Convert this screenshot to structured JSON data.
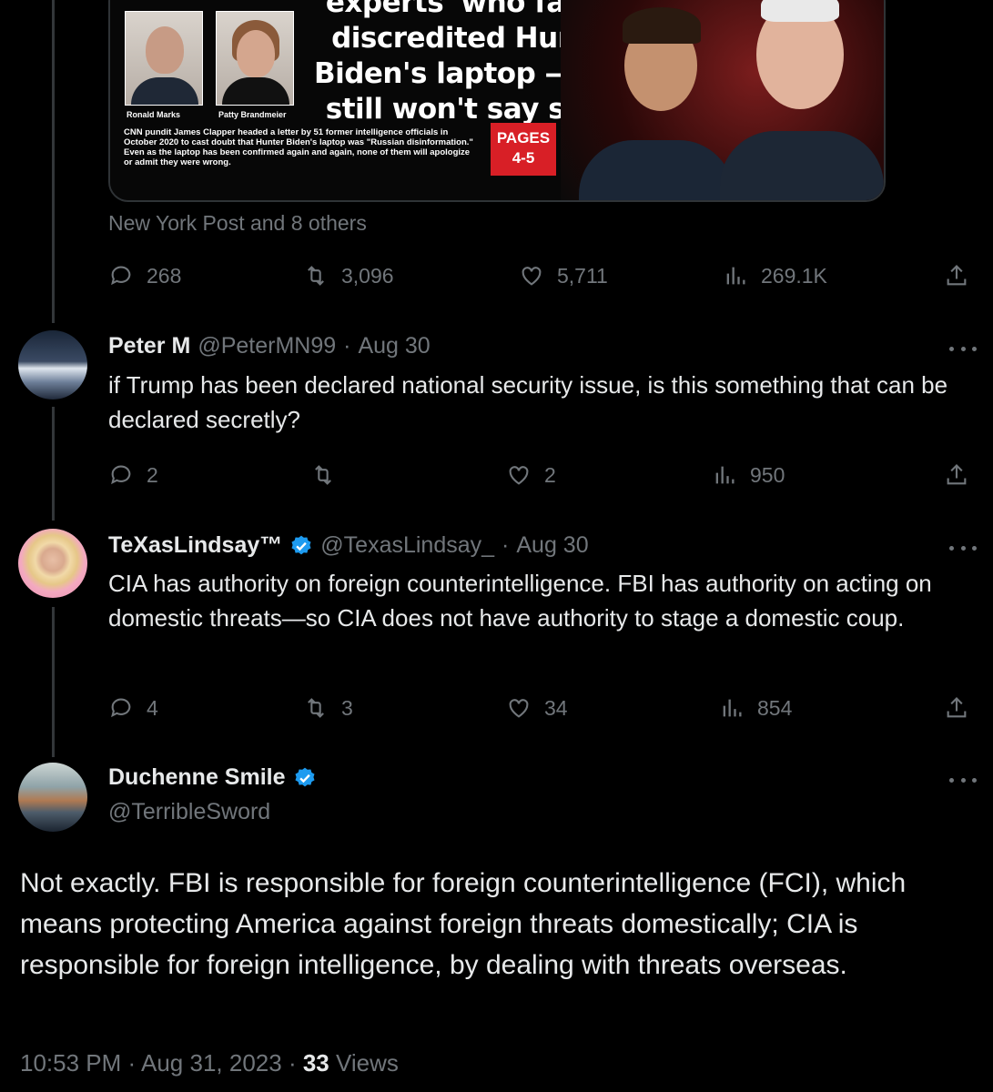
{
  "news_card": {
    "headline": "'experts' who falsely discredited Hunter Biden's laptop — and still won't say sorry",
    "photo_captions": [
      "Ronald Marks",
      "Patty Brandmeier"
    ],
    "body": "CNN pundit James Clapper headed a letter by 51 former intelligence officials in October 2020 to cast doubt that Hunter Biden's laptop was \"Russian disinformation.\" Even as the laptop has been confirmed again and again, none of them will apologize or admit they were wrong.",
    "pages_label": "PAGES",
    "pages_value": "4-5"
  },
  "source_line": "New York Post and 8 others",
  "main_post_actions": {
    "replies": "268",
    "reposts": "3,096",
    "likes": "5,711",
    "views": "269.1K"
  },
  "replies": [
    {
      "name": "Peter M",
      "handle": "@PeterMN99",
      "date": "Aug 30",
      "text": "if Trump has been declared national security issue, is this something that can be declared secretly?",
      "replies": "2",
      "reposts": "",
      "likes": "2",
      "views": "950"
    },
    {
      "name": "TeXasLindsay™",
      "handle": "@TexasLindsay_",
      "date": "Aug 30",
      "text": "CIA has authority on foreign counterintelligence. FBI has authority on acting on domestic threats—so CIA does not have authority to stage a domestic coup.",
      "replies": "4",
      "reposts": "3",
      "likes": "34",
      "views": "854"
    }
  ],
  "focused_post": {
    "name": "Duchenne Smile",
    "handle": "@TerribleSword",
    "text": "Not exactly.  FBI is responsible for foreign counterintelligence (FCI), which means protecting America against foreign threats domestically; CIA is responsible for foreign intelligence, by dealing with threats overseas.",
    "time": "10:53 PM",
    "date": "Aug 31, 2023",
    "views_count": "33",
    "views_label": "Views"
  },
  "separator": "·",
  "icons": [
    "reply-icon",
    "repost-icon",
    "like-icon",
    "views-icon",
    "share-icon",
    "more-icon",
    "verified-icon"
  ],
  "colors": {
    "background": "#000000",
    "text": "#e7e9ea",
    "muted": "#71767b",
    "verified": "#1d9bf0",
    "pages_red": "#d81f26"
  }
}
